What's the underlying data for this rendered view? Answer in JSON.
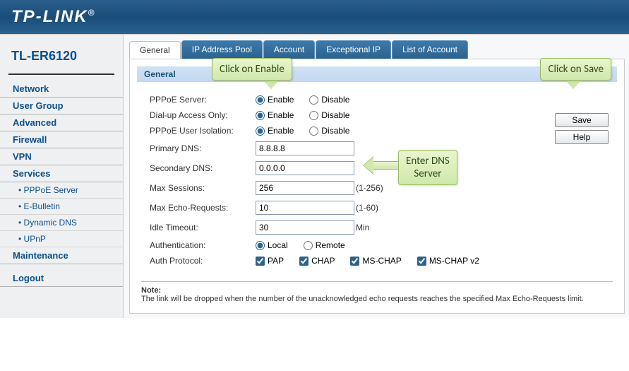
{
  "brand": "TP-LINK",
  "model": "TL-ER6120",
  "sidebar": {
    "items": [
      "Network",
      "User Group",
      "Advanced",
      "Firewall",
      "VPN",
      "Services"
    ],
    "sub_items": [
      "PPPoE Server",
      "E-Bulletin",
      "Dynamic DNS",
      "UPnP"
    ],
    "items2": [
      "Maintenance"
    ],
    "logout": "Logout"
  },
  "tabs": [
    "General",
    "IP Address Pool",
    "Account",
    "Exceptional IP",
    "List of Account"
  ],
  "section": "General",
  "form": {
    "pppoe_server": {
      "label": "PPPoE Server:",
      "opt1": "Enable",
      "opt2": "Disable"
    },
    "dialup": {
      "label": "Dial-up Access Only:",
      "opt1": "Enable",
      "opt2": "Disable"
    },
    "isolation": {
      "label": "PPPoE User Isolation:",
      "opt1": "Enable",
      "opt2": "Disable"
    },
    "primary_dns": {
      "label": "Primary DNS:",
      "value": "8.8.8.8"
    },
    "secondary_dns": {
      "label": "Secondary DNS:",
      "value": "0.0.0.0"
    },
    "max_sessions": {
      "label": "Max Sessions:",
      "value": "256",
      "suffix": "(1-256)"
    },
    "max_echo": {
      "label": "Max Echo-Requests:",
      "value": "10",
      "suffix": "(1-60)"
    },
    "idle": {
      "label": "Idle Timeout:",
      "value": "30",
      "suffix": "Min"
    },
    "auth": {
      "label": "Authentication:",
      "opt1": "Local",
      "opt2": "Remote"
    },
    "proto": {
      "label": "Auth Protocol:",
      "opts": [
        "PAP",
        "CHAP",
        "MS-CHAP",
        "MS-CHAP v2"
      ]
    }
  },
  "buttons": {
    "save": "Save",
    "help": "Help"
  },
  "note": {
    "title": "Note:",
    "body": "The link will be dropped when the number of the unacknowledged echo requests reaches the specified Max Echo-Requests limit."
  },
  "callouts": {
    "enable": "Click on Enable",
    "save": "Click on Save",
    "dns": "Enter DNS\nServer"
  }
}
